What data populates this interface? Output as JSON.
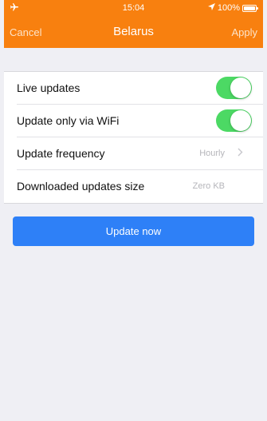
{
  "status_bar": {
    "airplane_icon": "airplane-icon",
    "time": "15:04",
    "location_icon": "location-arrow-icon",
    "battery_percent": "100%",
    "battery_level": 1.0
  },
  "navbar": {
    "cancel_label": "Cancel",
    "title": "Belarus",
    "apply_label": "Apply"
  },
  "settings": {
    "live_updates": {
      "label": "Live updates",
      "enabled": true
    },
    "wifi_only": {
      "label": "Update only via WiFi",
      "enabled": true
    },
    "frequency": {
      "label": "Update frequency",
      "value": "Hourly"
    },
    "downloaded_size": {
      "label": "Downloaded updates size",
      "value": "Zero KB"
    }
  },
  "update_button_label": "Update now",
  "colors": {
    "header": "#f8800f",
    "toggle_on": "#4cd964",
    "primary_button": "#2e80f7",
    "background": "#efeff4"
  }
}
